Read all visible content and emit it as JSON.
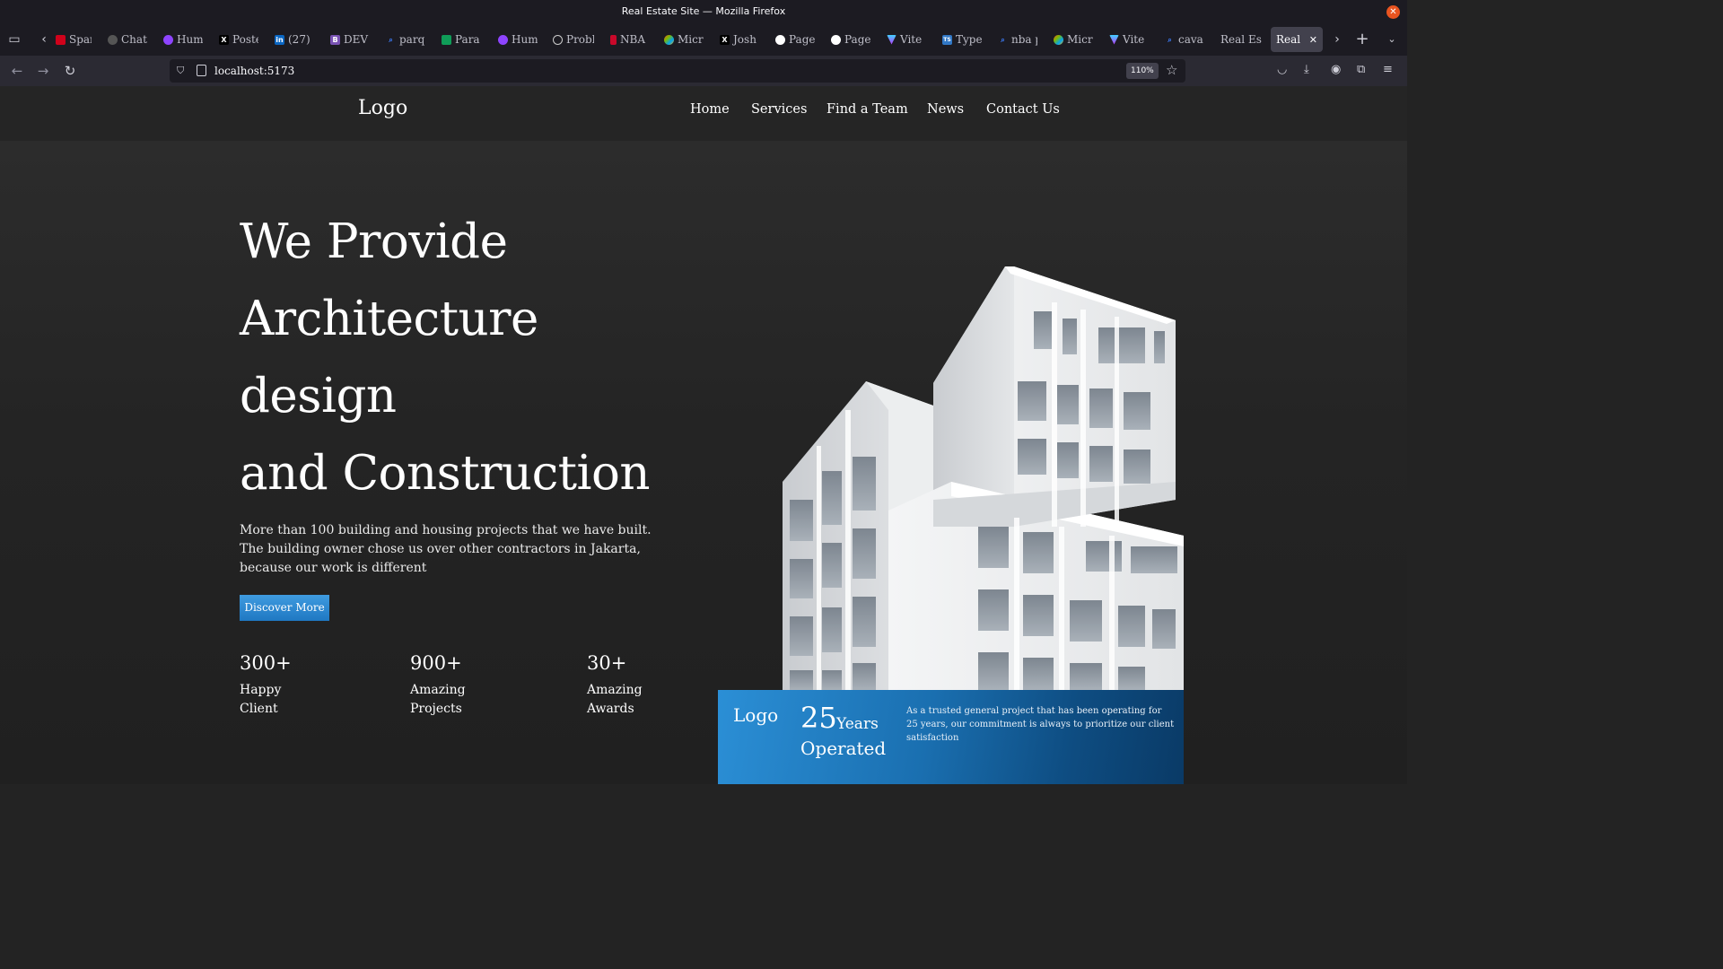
{
  "browser": {
    "window_title": "Real Estate Site — Mozilla Firefox",
    "tabs": [
      {
        "label": "Spar",
        "icon": "spartan-icon",
        "color": "#d0021b"
      },
      {
        "label": "Chat",
        "icon": "openai-icon",
        "color": "#555555"
      },
      {
        "label": "Hum",
        "icon": "huggingface-icon",
        "color": "#8e44ff"
      },
      {
        "label": "Poste",
        "icon": "x-icon",
        "color": "#000000"
      },
      {
        "label": "(27)",
        "icon": "linkedin-icon",
        "color": "#0a66c2"
      },
      {
        "label": "DEV",
        "icon": "bootstrap-icon",
        "color": "#7952b3"
      },
      {
        "label": "parq",
        "icon": "search-icon",
        "color": "#3d7eff"
      },
      {
        "label": "Para",
        "icon": "sheets-icon",
        "color": "#0f9d58"
      },
      {
        "label": "Hum",
        "icon": "huggingface-icon",
        "color": "#8e44ff"
      },
      {
        "label": "Probl",
        "icon": "info-icon",
        "color": "#666666"
      },
      {
        "label": "NBA",
        "icon": "nba-icon",
        "color": "#c9082a"
      },
      {
        "label": "Micr",
        "icon": "microsoft-icon",
        "color": "#f25022"
      },
      {
        "label": "Josh",
        "icon": "x-icon",
        "color": "#000000"
      },
      {
        "label": "Page",
        "icon": "github-icon",
        "color": "#333333"
      },
      {
        "label": "Page",
        "icon": "github-icon",
        "color": "#333333"
      },
      {
        "label": "Vite",
        "icon": "vite-icon",
        "color": "#9f5cff"
      },
      {
        "label": "Type",
        "icon": "typescript-icon",
        "color": "#3178c6"
      },
      {
        "label": "nba p",
        "icon": "search-icon",
        "color": "#3d7eff"
      },
      {
        "label": "Micr",
        "icon": "microsoft-icon",
        "color": "#f25022"
      },
      {
        "label": "Vite",
        "icon": "vite-icon",
        "color": "#9f5cff"
      },
      {
        "label": "cava",
        "icon": "search-icon",
        "color": "#3d7eff"
      },
      {
        "label": "Real Est",
        "icon": "",
        "color": ""
      },
      {
        "label": "Real E",
        "icon": "",
        "color": "",
        "active": true
      }
    ],
    "url": "localhost:5173",
    "zoom": "110%"
  },
  "site": {
    "logo": "Logo",
    "nav": [
      "Home",
      "Services",
      "Find a Team",
      "News",
      "Contact Us"
    ],
    "hero": {
      "title_lines": [
        "We Provide",
        "Architecture",
        "design",
        "and Construction"
      ],
      "description": "More than 100 building and housing projects that we have built. The building owner chose us over other contractors in Jakarta, because our work is different",
      "cta": "Discover More",
      "stats": [
        {
          "value": "300+",
          "label": "Happy Client"
        },
        {
          "value": "900+",
          "label": "Amazing Projects"
        },
        {
          "value": "30+",
          "label": "Amazing Awards"
        }
      ]
    },
    "card": {
      "logo": "Logo",
      "years_number": "25",
      "years_word": "Years",
      "operated": "Operated",
      "description": "As a trusted general project that has been operating for 25 years, our commitment is always to prioritize our client satisfaction"
    }
  },
  "colors": {
    "accent": "#2b8fd6",
    "background": "#232323"
  }
}
